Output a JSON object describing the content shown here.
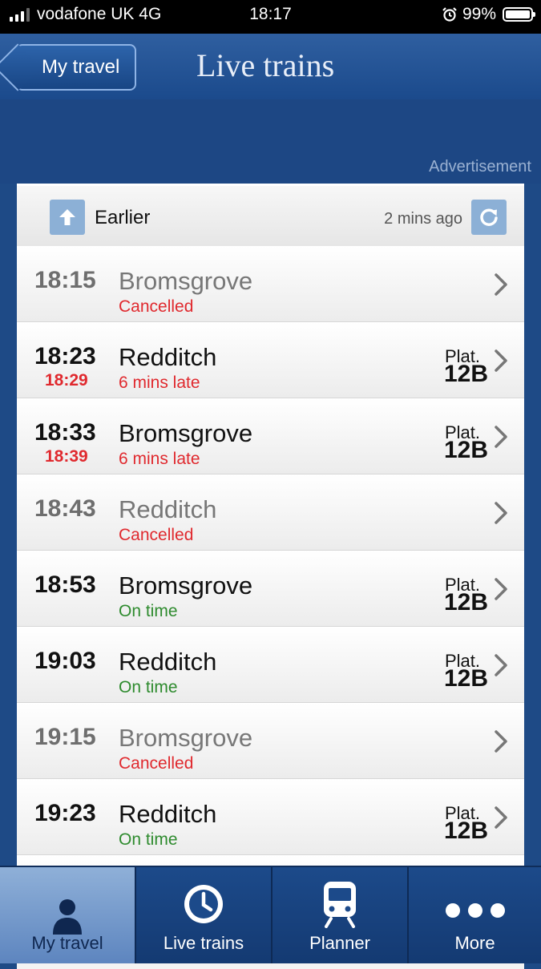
{
  "status_bar": {
    "carrier": "vodafone UK",
    "network": "4G",
    "time": "18:17",
    "battery": "99%",
    "battery_level": 0.99
  },
  "nav": {
    "back_label": "My travel",
    "title": "Live trains"
  },
  "ad": {
    "label": "Advertisement"
  },
  "list_header": {
    "earlier_label": "Earlier",
    "updated_text": "2 mins ago"
  },
  "trains": [
    {
      "time": "18:15",
      "expected": "",
      "destination": "Bromsgrove",
      "status": "Cancelled",
      "status_color": "#e0292e",
      "plat_label": "",
      "platform": "",
      "cancelled": true
    },
    {
      "time": "18:23",
      "expected": "18:29",
      "destination": "Redditch",
      "status": "6 mins late",
      "status_color": "#e0292e",
      "plat_label": "Plat.",
      "platform": "12B",
      "cancelled": false
    },
    {
      "time": "18:33",
      "expected": "18:39",
      "destination": "Bromsgrove",
      "status": "6 mins late",
      "status_color": "#e0292e",
      "plat_label": "Plat.",
      "platform": "12B",
      "cancelled": false
    },
    {
      "time": "18:43",
      "expected": "",
      "destination": "Redditch",
      "status": "Cancelled",
      "status_color": "#e0292e",
      "plat_label": "",
      "platform": "",
      "cancelled": true
    },
    {
      "time": "18:53",
      "expected": "",
      "destination": "Bromsgrove",
      "status": "On time",
      "status_color": "#2e8b2e",
      "plat_label": "Plat.",
      "platform": "12B",
      "cancelled": false
    },
    {
      "time": "19:03",
      "expected": "",
      "destination": "Redditch",
      "status": "On time",
      "status_color": "#2e8b2e",
      "plat_label": "Plat.",
      "platform": "12B",
      "cancelled": false
    },
    {
      "time": "19:15",
      "expected": "",
      "destination": "Bromsgrove",
      "status": "Cancelled",
      "status_color": "#e0292e",
      "plat_label": "",
      "platform": "",
      "cancelled": true
    },
    {
      "time": "19:23",
      "expected": "",
      "destination": "Redditch",
      "status": "On time",
      "status_color": "#2e8b2e",
      "plat_label": "Plat.",
      "platform": "12B",
      "cancelled": false
    }
  ],
  "tabs": [
    {
      "label": "My travel",
      "icon": "person-icon",
      "active": true
    },
    {
      "label": "Live trains",
      "icon": "clock-icon",
      "active": false
    },
    {
      "label": "Planner",
      "icon": "train-icon",
      "active": false
    },
    {
      "label": "More",
      "icon": "more-dots-icon",
      "active": false
    }
  ]
}
